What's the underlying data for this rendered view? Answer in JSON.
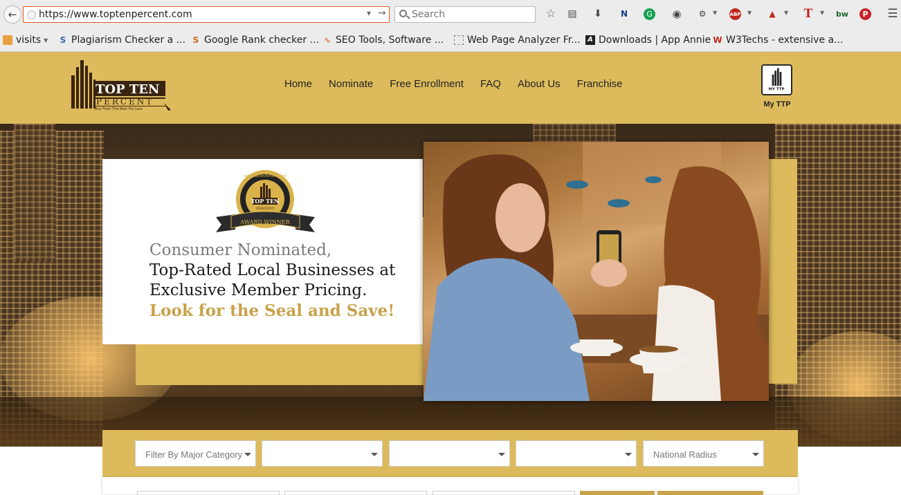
{
  "browser": {
    "url": "https://www.toptenpercent.com",
    "search_placeholder": "Search",
    "bookmarks": [
      {
        "label": "visits",
        "icon": "folder-icon"
      },
      {
        "label": "Plagiarism Checker a ...",
        "icon": "s-logo-icon"
      },
      {
        "label": "Google Rank checker ...",
        "icon": "s-logo-icon"
      },
      {
        "label": "SEO Tools, Software ...",
        "icon": "pulse-icon"
      },
      {
        "label": "Web Page Analyzer Fr...",
        "icon": "page-icon"
      },
      {
        "label": "Downloads | App Annie",
        "icon": "app-annie-icon"
      },
      {
        "label": "W3Techs - extensive a...",
        "icon": "w3techs-icon"
      }
    ]
  },
  "site": {
    "logo_text_1": "TOP TEN",
    "logo_text_2": "PERCENT",
    "logo_tagline": "Buy From The Best For Less",
    "nav": [
      "Home",
      "Nominate",
      "Free Enrollment",
      "FAQ",
      "About Us",
      "Franchise"
    ],
    "my_ttp_icon_text": "MY TTP",
    "my_ttp_label": "My TTP"
  },
  "hero": {
    "seal_url_text": "www.TopTenPercent.com",
    "seal_name_1": "TOP TEN",
    "seal_name_2": "PERCENT",
    "seal_ribbon": "AWARD WINNER",
    "line1": "Consumer Nominated,",
    "line2": "Top-Rated Local Businesses at",
    "line3": "Exclusive Member Pricing.",
    "line4": "Look for the Seal and Save!"
  },
  "filters": {
    "category": "Filter By Major Category",
    "sub1": "",
    "sub2": "",
    "sub3": "",
    "radius": "National Radius"
  },
  "colors": {
    "gold": "#ddbb5c",
    "gold_text": "#c8a24a",
    "logo_brown": "#3a2410"
  }
}
